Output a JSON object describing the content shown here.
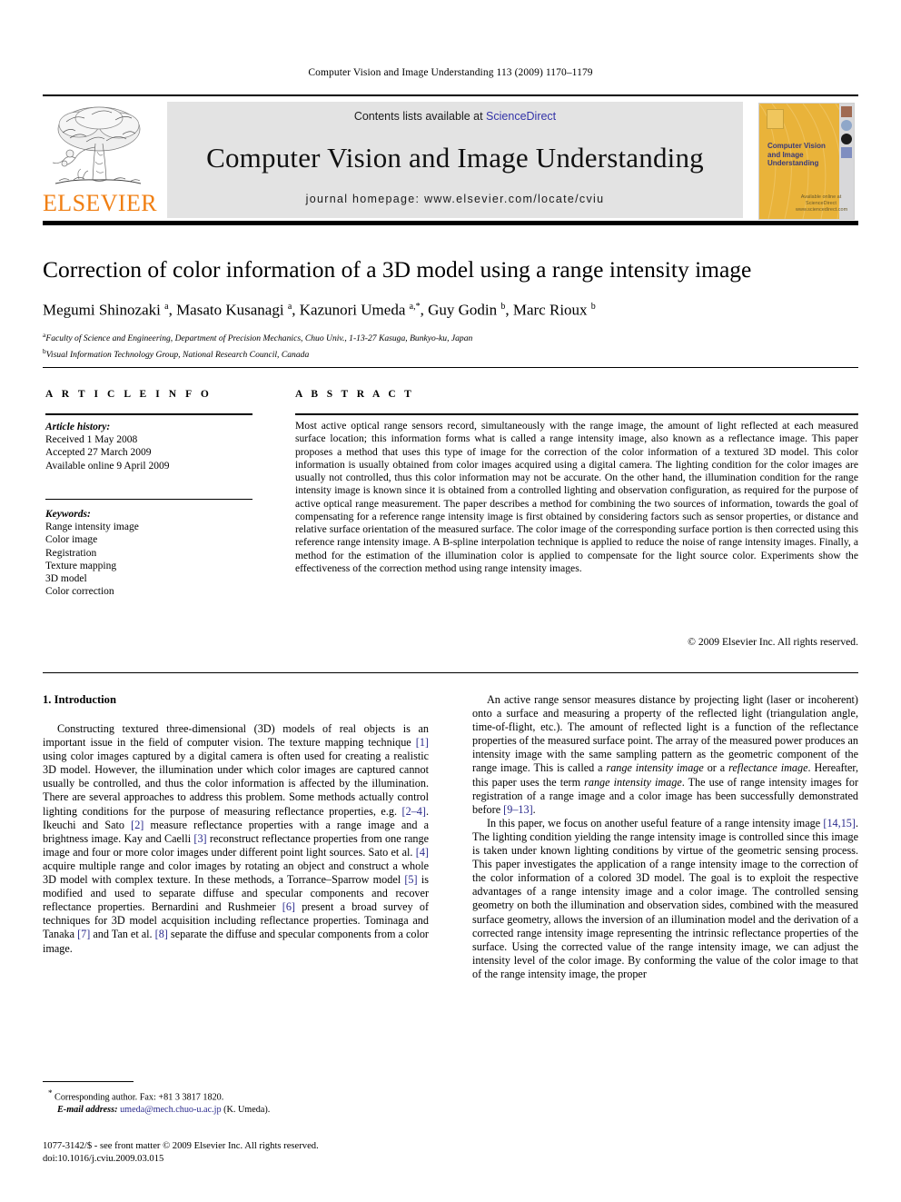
{
  "running_head": "Computer Vision and Image Understanding 113 (2009) 1170–1179",
  "journal_header": {
    "contents_prefix": "Contents lists available at ",
    "sciencedirect": "ScienceDirect",
    "journal_title": "Computer Vision and Image Understanding",
    "homepage": "journal homepage: www.elsevier.com/locate/cviu",
    "publisher_logo_text": "ELSEVIER",
    "cover": {
      "title_lines": "Computer Vision and Image Understanding",
      "footer": "Available online at ScienceDirect www.sciencedirect.com"
    },
    "link_color": "#3333a8",
    "logo_color": "#f07f13",
    "band_color": "#e3e3e3",
    "cover_color": "#e9b33a"
  },
  "article": {
    "title": "Correction of color information of a 3D model using a range intensity image",
    "authors_html": "Megumi Shinozaki <sup>a</sup>, Masato Kusanagi <sup>a</sup>, Kazunori Umeda <sup>a,*</sup>, Guy Godin <sup>b</sup>, Marc Rioux <sup>b</sup>",
    "affiliations": [
      {
        "marker": "a",
        "text": "Faculty of Science and Engineering, Department of Precision Mechanics, Chuo Univ., 1-13-27 Kasuga, Bunkyo-ku, Japan"
      },
      {
        "marker": "b",
        "text": "Visual Information Technology Group, National Research Council, Canada"
      }
    ]
  },
  "article_info": {
    "heading": "A R T I C L E   I N F O",
    "history_label": "Article history:",
    "history": [
      "Received 1 May 2008",
      "Accepted 27 March 2009",
      "Available online 9 April 2009"
    ],
    "keywords_label": "Keywords:",
    "keywords": [
      "Range intensity image",
      "Color image",
      "Registration",
      "Texture mapping",
      "3D model",
      "Color correction"
    ]
  },
  "abstract": {
    "heading": "A B S T R A C T",
    "text": "Most active optical range sensors record, simultaneously with the range image, the amount of light reflected at each measured surface location; this information forms what is called a range intensity image, also known as a reflectance image. This paper proposes a method that uses this type of image for the correction of the color information of a textured 3D model. This color information is usually obtained from color images acquired using a digital camera. The lighting condition for the color images are usually not controlled, thus this color information may not be accurate. On the other hand, the illumination condition for the range intensity image is known since it is obtained from a controlled lighting and observation configuration, as required for the purpose of active optical range measurement. The paper describes a method for combining the two sources of information, towards the goal of compensating for a reference range intensity image is first obtained by considering factors such as sensor properties, or distance and relative surface orientation of the measured surface. The color image of the corresponding surface portion is then corrected using this reference range intensity image. A B-spline interpolation technique is applied to reduce the noise of range intensity images. Finally, a method for the estimation of the illumination color is applied to compensate for the light source color. Experiments show the effectiveness of the correction method using range intensity images.",
    "copyright": "© 2009 Elsevier Inc. All rights reserved."
  },
  "body": {
    "section_heading": "1. Introduction",
    "left_column_html": "<p>Constructing textured three-dimensional (3D) models of real objects is an important issue in the field of computer vision. The texture mapping technique <span class=\"ref\">[1]</span> using color images captured by a digital camera is often used for creating a realistic 3D model. However, the illumination under which color images are captured cannot usually be controlled, and thus the color information is affected by the illumination. There are several approaches to address this problem. Some methods actually control lighting conditions for the purpose of measuring reflectance properties, e.g. <span class=\"ref\">[2–4]</span>. Ikeuchi and Sato <span class=\"ref\">[2]</span> measure reflectance properties with a range image and a brightness image. Kay and Caelli <span class=\"ref\">[3]</span> reconstruct reflectance properties from one range image and four or more color images under different point light sources. Sato et al. <span class=\"ref\">[4]</span> acquire multiple range and color images by rotating an object and construct a whole 3D model with complex texture. In these methods, a Torrance–Sparrow model <span class=\"ref\">[5]</span> is modified and used to separate diffuse and specular components and recover reflectance properties. Bernardini and Rushmeier <span class=\"ref\">[6]</span> present a broad survey of techniques for 3D model acquisition including reflectance properties. Tominaga and Tanaka <span class=\"ref\">[7]</span> and Tan et al. <span class=\"ref\">[8]</span> separate the diffuse and specular components from a color image.</p>",
    "right_column_html": "<p>An active range sensor measures distance by projecting light (laser or incoherent) onto a surface and measuring a property of the reflected light (triangulation angle, time-of-flight, etc.). The amount of reflected light is a function of the reflectance properties of the measured surface point. The array of the measured power produces an intensity image with the same sampling pattern as the geometric component of the range image. This is called a <span class=\"it\">range intensity image</span> or a <span class=\"it\">reflectance image</span>. Hereafter, this paper uses the term <span class=\"it\">range intensity image</span>. The use of range intensity images for registration of a range image and a color image has been successfully demonstrated before <span class=\"ref\">[9–13]</span>.</p><p>In this paper, we focus on another useful feature of a range intensity image <span class=\"ref\">[14,15]</span>. The lighting condition yielding the range intensity image is controlled since this image is taken under known lighting conditions by virtue of the geometric sensing process. This paper investigates the application of a range intensity image to the correction of the color information of a colored 3D model. The goal is to exploit the respective advantages of a range intensity image and a color image. The controlled sensing geometry on both the illumination and observation sides, combined with the measured surface geometry, allows the inversion of an illumination model and the derivation of a corrected range intensity image representing the intrinsic reflectance properties of the surface. Using the corrected value of the range intensity image, we can adjust the intensity level of the color image. By conforming the value of the color image to that of the range intensity image, the proper</p>"
  },
  "footnote": {
    "corresponding": "Corresponding author. Fax: +81 3 3817 1820.",
    "email_label": "E-mail address:",
    "email": "umeda@mech.chuo-u.ac.jp",
    "email_owner": "(K. Umeda)."
  },
  "imprint": {
    "issn_line": "1077-3142/$ - see front matter © 2009 Elsevier Inc. All rights reserved.",
    "doi_line": "doi:10.1016/j.cviu.2009.03.015"
  }
}
